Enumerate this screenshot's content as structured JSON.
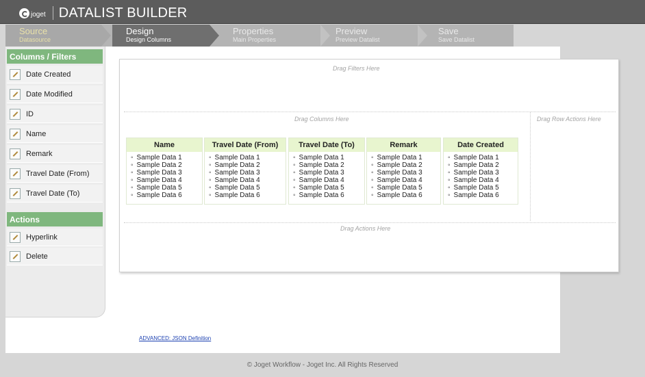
{
  "header": {
    "logo_text": "joget",
    "title": "DATALIST BUILDER"
  },
  "steps": [
    {
      "title": "Source",
      "subtitle": "Datasource"
    },
    {
      "title": "Design",
      "subtitle": "Design Columns"
    },
    {
      "title": "Properties",
      "subtitle": "Main Properties"
    },
    {
      "title": "Preview",
      "subtitle": "Preview Datalist"
    },
    {
      "title": "Save",
      "subtitle": "Save Datalist"
    }
  ],
  "sidebar": {
    "columns_header": "Columns / Filters",
    "columns": [
      "Date Created",
      "Date Modified",
      "ID",
      "Name",
      "Remark",
      "Travel Date (From)",
      "Travel Date (To)"
    ],
    "actions_header": "Actions",
    "actions": [
      "Hyperlink",
      "Delete"
    ]
  },
  "canvas": {
    "drag_filters": "Drag Filters Here",
    "drag_columns": "Drag Columns Here",
    "drag_row_actions": "Drag Row Actions Here",
    "drag_actions": "Drag Actions Here"
  },
  "columns": [
    {
      "header": "Name",
      "rows": [
        "Sample Data 1",
        "Sample Data 2",
        "Sample Data 3",
        "Sample Data 4",
        "Sample Data 5",
        "Sample Data 6"
      ]
    },
    {
      "header": "Travel Date (From)",
      "rows": [
        "Sample Data 1",
        "Sample Data 2",
        "Sample Data 3",
        "Sample Data 4",
        "Sample Data 5",
        "Sample Data 6"
      ]
    },
    {
      "header": "Travel Date (To)",
      "rows": [
        "Sample Data 1",
        "Sample Data 2",
        "Sample Data 3",
        "Sample Data 4",
        "Sample Data 5",
        "Sample Data 6"
      ]
    },
    {
      "header": "Remark",
      "rows": [
        "Sample Data 1",
        "Sample Data 2",
        "Sample Data 3",
        "Sample Data 4",
        "Sample Data 5",
        "Sample Data 6"
      ]
    },
    {
      "header": "Date Created",
      "rows": [
        "Sample Data 1",
        "Sample Data 2",
        "Sample Data 3",
        "Sample Data 4",
        "Sample Data 5",
        "Sample Data 6"
      ]
    }
  ],
  "links": {
    "advanced": "ADVANCED: JSON Definition"
  },
  "footer": {
    "copyright": "© Joget Workflow - Joget Inc. All Rights Reserved"
  },
  "colors": {
    "header_bg": "#5c5c5c",
    "sidebar_head": "#7fb77e",
    "column_head": "#e8f5cf",
    "active_step": "#6f6f6f"
  }
}
